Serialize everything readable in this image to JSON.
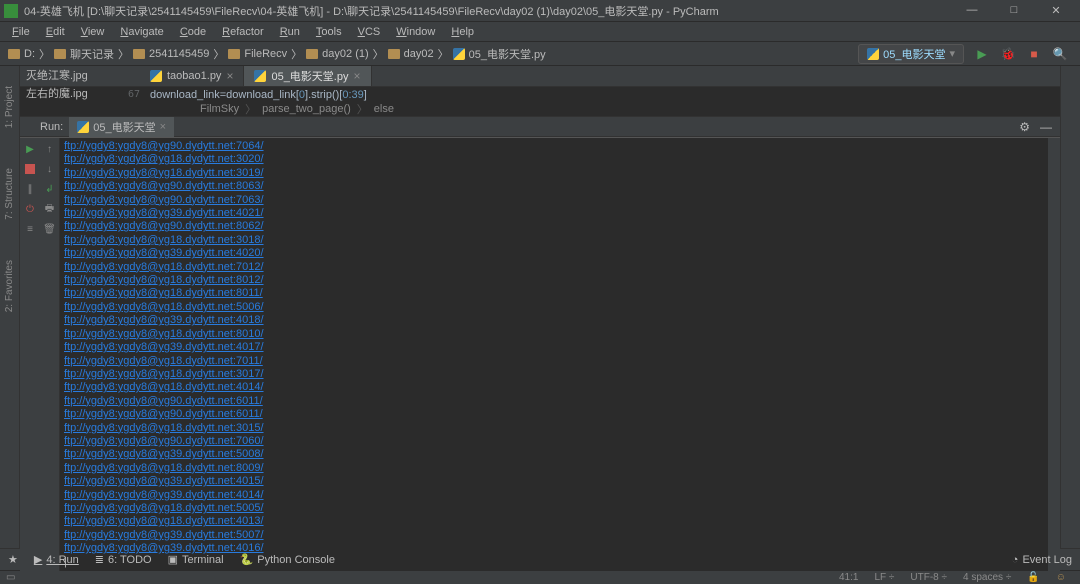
{
  "title": "04-英雄飞机 [D:\\聊天记录\\2541145459\\FileRecv\\04-英雄飞机] - D:\\聊天记录\\2541145459\\FileRecv\\day02 (1)\\day02\\05_电影天堂.py - PyCharm",
  "menu": [
    "File",
    "Edit",
    "View",
    "Navigate",
    "Code",
    "Refactor",
    "Run",
    "Tools",
    "VCS",
    "Window",
    "Help"
  ],
  "nav": {
    "drive": "D:",
    "segments": [
      "聊天记录",
      "2541145459",
      "FileRecv",
      "day02 (1)",
      "day02",
      "05_电影天堂.py"
    ]
  },
  "runconfig": "05_电影天堂",
  "tree": {
    "items": [
      "灭绝江寒.jpg",
      "左右的魔.ipg"
    ],
    "selected": "05_电影天堂"
  },
  "tabs": [
    {
      "label": "taobao1.py",
      "active": false
    },
    {
      "label": "05_电影天堂.py",
      "active": true
    }
  ],
  "editor": {
    "line_no": "67",
    "code_prefix": "download_link=download_link[",
    "code_idx0": "0",
    "code_mid": "].strip()[",
    "code_slice": "0:39",
    "code_end": "]"
  },
  "crumbs": [
    "FilmSky",
    "parse_two_page()",
    "else"
  ],
  "run_tab": "05_电影天堂",
  "run_label": "Run:",
  "output_lines": [
    "ftp://ygdy8:ygdy8@yg90.dydytt.net:7064/",
    "ftp://ygdy8:ygdy8@yg18.dydytt.net:3020/",
    "ftp://ygdy8:ygdy8@yg18.dydytt.net:3019/",
    "ftp://ygdy8:ygdy8@yg90.dydytt.net:8063/",
    "ftp://ygdy8:ygdy8@yg90.dydytt.net:7063/",
    "ftp://ygdy8:ygdy8@yg39.dydytt.net:4021/",
    "ftp://ygdy8:ygdy8@yg90.dydytt.net:8062/",
    "ftp://ygdy8:ygdy8@yg18.dydytt.net:3018/",
    "ftp://ygdy8:ygdy8@yg39.dydytt.net:4020/",
    "ftp://ygdy8:ygdy8@yg18.dydytt.net:7012/",
    "ftp://ygdy8:ygdy8@yg18.dydytt.net:8012/",
    "ftp://ygdy8:ygdy8@yg18.dydytt.net:8011/",
    "ftp://ygdy8:ygdy8@yg18.dydytt.net:5006/",
    "ftp://ygdy8:ygdy8@yg39.dydytt.net:4018/",
    "ftp://ygdy8:ygdy8@yg18.dydytt.net:8010/",
    "ftp://ygdy8:ygdy8@yg39.dydytt.net:4017/",
    "ftp://ygdy8:ygdy8@yg18.dydytt.net:7011/",
    "ftp://ygdy8:ygdy8@yg18.dydytt.net:3017/",
    "ftp://ygdy8:ygdy8@yg18.dydytt.net:4014/",
    "ftp://ygdy8:ygdy8@yg90.dydytt.net:6011/",
    "ftp://ygdy8:ygdy8@yg90.dydytt.net:6011/",
    "ftp://ygdy8:ygdy8@yg18.dydytt.net:3015/",
    "ftp://ygdy8:ygdy8@yg90.dydytt.net:7060/",
    "ftp://ygdy8:ygdy8@yg39.dydytt.net:5008/",
    "ftp://ygdy8:ygdy8@yg18.dydytt.net:8009/",
    "ftp://ygdy8:ygdy8@yg39.dydytt.net:4015/",
    "ftp://ygdy8:ygdy8@yg39.dydytt.net:4014/",
    "ftp://ygdy8:ygdy8@yg18.dydytt.net:5005/",
    "ftp://ygdy8:ygdy8@yg18.dydytt.net:4013/",
    "ftp://ygdy8:ygdy8@yg39.dydytt.net:5007/",
    "ftp://ygdy8:ygdy8@yg39.dydytt.net:4016/"
  ],
  "left_tabs": [
    "1: Project",
    "7: Structure",
    "2: Favorites"
  ],
  "toolwins": {
    "run": "4: Run",
    "todo": "6: TODO",
    "terminal": "Terminal",
    "python": "Python Console",
    "eventlog": "Event Log"
  },
  "status": {
    "pos": "41:1",
    "lf": "LF",
    "enc": "UTF-8",
    "indent": "4 spaces"
  }
}
